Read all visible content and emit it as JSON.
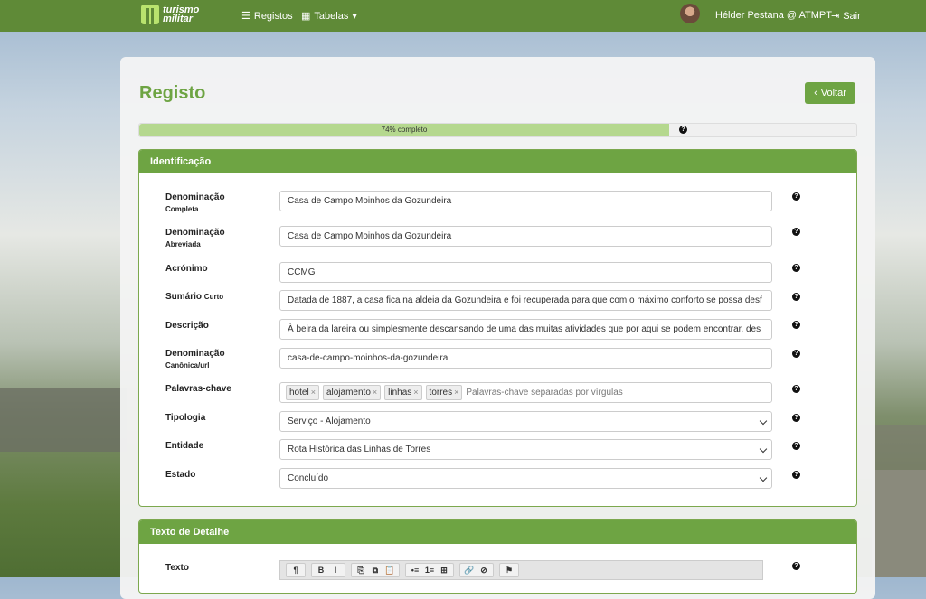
{
  "nav": {
    "logo_line1": "turismo",
    "logo_line2": "militar",
    "registos": "Registos",
    "tabelas": "Tabelas",
    "user": "Hélder Pestana @ ATMPT",
    "sair": "Sair"
  },
  "page": {
    "title": "Registo",
    "back": "Voltar",
    "progress_text": "74% completo",
    "progress_value": 0.74
  },
  "identificacao": {
    "header": "Identificação",
    "fields": [
      {
        "label": "Denominação",
        "sub": "Completa",
        "value": "Casa de Campo Moinhos da Gozundeira"
      },
      {
        "label": "Denominação",
        "sub": "Abreviada",
        "value": "Casa de Campo Moinhos da Gozundeira"
      },
      {
        "label": "Acrónimo",
        "sub": "",
        "value": "CCMG"
      },
      {
        "label": "Sumário",
        "sub": "Curto",
        "value": "Datada de 1887, a casa fica na aldeia da Gozundeira e foi recuperada para que com o máximo conforto se possa desf"
      },
      {
        "label": "Descrição",
        "sub": "",
        "value": "À beira da lareira ou simplesmente descansando de uma das muitas atividades que por aqui se podem encontrar, des"
      },
      {
        "label": "Denominação",
        "sub": "Canônica/url",
        "value": "casa-de-campo-moinhos-da-gozundeira"
      }
    ],
    "keywords_label": "Palavras-chave",
    "tags": [
      "hotel",
      "alojamento",
      "linhas",
      "torres"
    ],
    "keywords_placeholder": "Palavras-chave separadas por vírgulas",
    "tipologia_label": "Tipologia",
    "tipologia_value": "Serviço - Alojamento",
    "entidade_label": "Entidade",
    "entidade_value": "Rota Histórica das Linhas de Torres",
    "estado_label": "Estado",
    "estado_value": "Concluído"
  },
  "detalhe": {
    "header": "Texto de Detalhe",
    "texto_label": "Texto",
    "toolbar": [
      "¶",
      "B",
      "I",
      "⎘",
      "⧉",
      "📋",
      "•≡",
      "1≡",
      "⊞",
      "🔗",
      "⊘",
      "⚑"
    ]
  },
  "colors": {
    "accent": "#6ea443",
    "navbar": "#5f8a37",
    "progress": "#b5d88e"
  }
}
